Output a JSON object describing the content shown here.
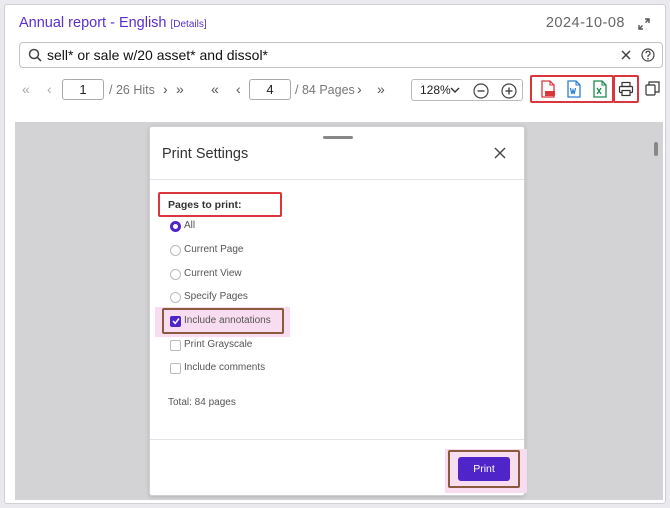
{
  "header": {
    "title": "Annual report - English",
    "details_label": "[Details]",
    "date": "2024-10-08"
  },
  "search": {
    "query": "sell* or sale w/20 asset* and dissol*"
  },
  "toolbar": {
    "hit_current": "1",
    "hit_total": "/ 26 Hits",
    "page_current": "4",
    "page_total": "/ 84 Pages",
    "zoom": "128%"
  },
  "icons": {
    "search": "search-icon",
    "clear": "close-icon",
    "help": "help-icon",
    "expand": "expand-icon",
    "pdf": "pdf-file-icon",
    "word": "word-file-icon",
    "excel": "excel-file-icon",
    "print": "printer-icon",
    "zoom_out": "zoom-out-icon",
    "zoom_in": "zoom-in-icon"
  },
  "dialog": {
    "title": "Print Settings",
    "pages_label": "Pages to print:",
    "page_options": [
      {
        "label": "All",
        "selected": true
      },
      {
        "label": "Current Page",
        "selected": false
      },
      {
        "label": "Current View",
        "selected": false
      },
      {
        "label": "Specify Pages",
        "selected": false
      }
    ],
    "checkboxes": [
      {
        "label": "Include annotations",
        "checked": true
      },
      {
        "label": "Print Grayscale",
        "checked": false
      },
      {
        "label": "Include comments",
        "checked": false
      }
    ],
    "total": "Total: 84 pages",
    "print_label": "Print"
  },
  "colors": {
    "accent": "#4f24c9",
    "link": "#5a2fd0",
    "highlight_red": "#d9363e",
    "highlight_brown": "#8b5a3c"
  }
}
